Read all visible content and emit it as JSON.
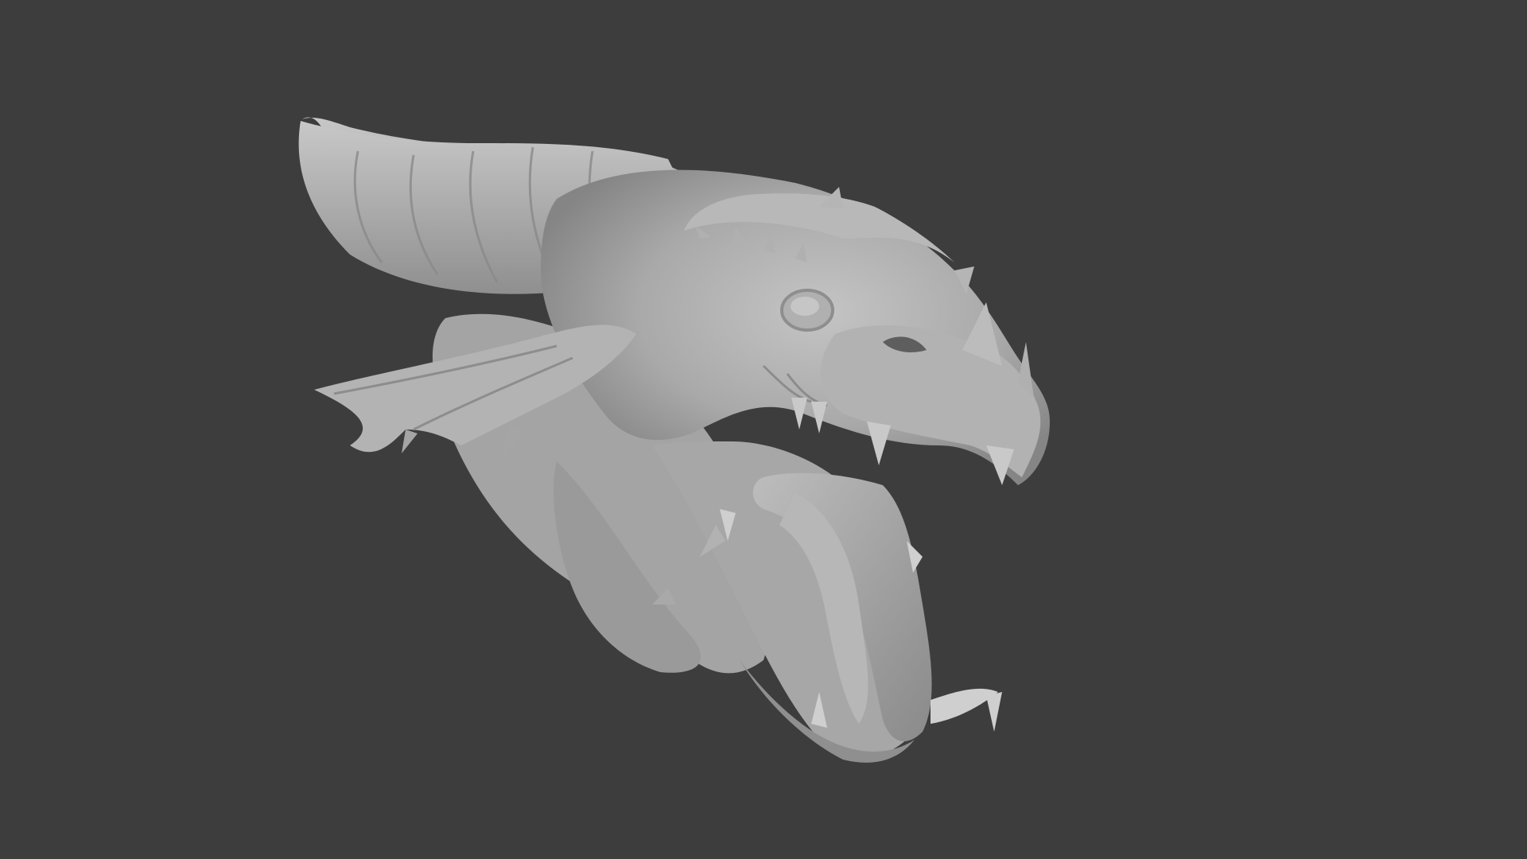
{
  "viewport": {
    "background_color": "#3d3d3d",
    "model_color": "#a8a8a8",
    "model_highlight": "#c8c8c8",
    "model_shadow": "#6e6e6e",
    "model_subject": "dragon-head-sculpt"
  }
}
